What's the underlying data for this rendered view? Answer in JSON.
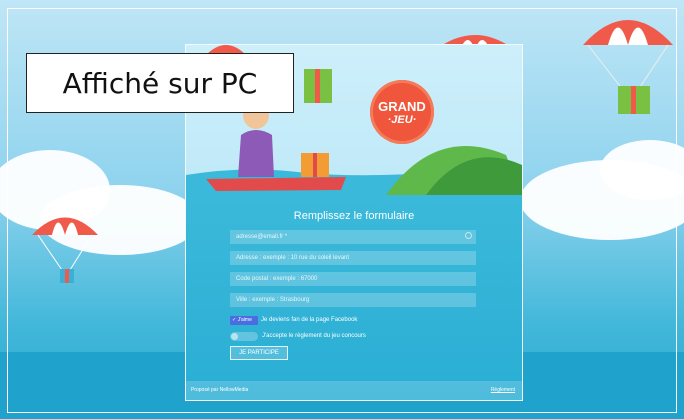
{
  "overlay": {
    "label": "Affiché sur PC"
  },
  "badge": {
    "line1": "GRAND",
    "line2": "·JEU·"
  },
  "form": {
    "title": "Remplissez le formulaire",
    "email_placeholder": "adresse@email.fr *",
    "address_placeholder": "Adresse : exemple : 10 rue du soleil levant",
    "postcode_placeholder": "Code postal : exemple : 67000",
    "city_placeholder": "Ville : exemple : Strasbourg",
    "like_button": "✓ J'aime",
    "facebook_label": "Je deviens fan de la page Facebook",
    "rules_label": "J'accepte le règlement du jeu concours",
    "submit_label": "JE PARTICIPE"
  },
  "footer": {
    "credit": "Proposé par NellowMedia",
    "rules_link": "Règlement"
  },
  "colors": {
    "sky": "#8fd3ee",
    "form_bg": "#2aaed4",
    "badge": "#f0563c",
    "boat": "#e24b4b"
  }
}
